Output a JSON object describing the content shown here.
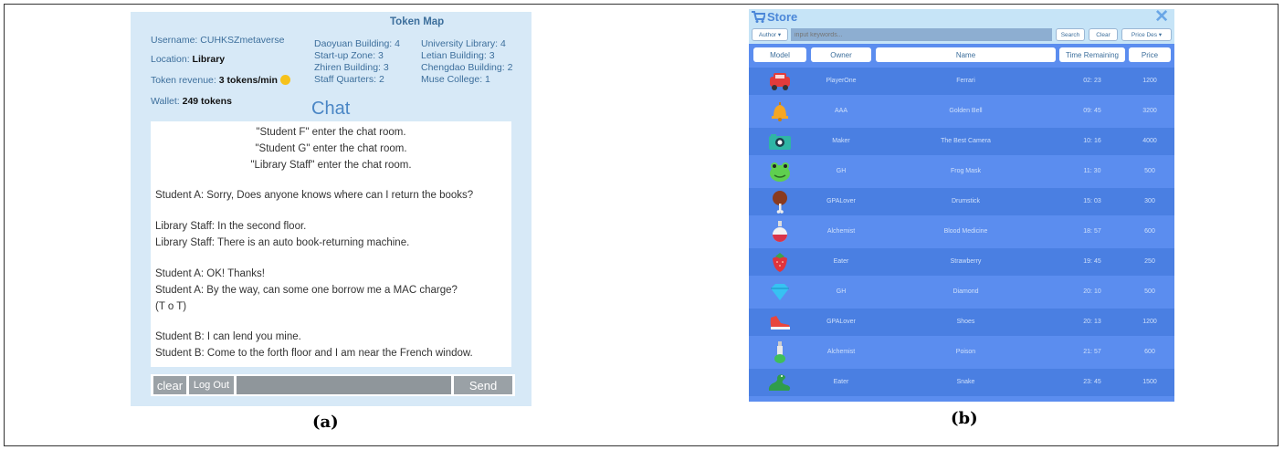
{
  "captions": {
    "a": "(a)",
    "b": "(b)"
  },
  "panel_a": {
    "username_label": "Username: ",
    "username_value": "CUHKSZmetaverse",
    "location_label": "Location: ",
    "location_value": "Library",
    "token_revenue_label": "Token revenue: ",
    "token_revenue_value": "3 tokens/min",
    "wallet_label": "Wallet: ",
    "wallet_value": "249 tokens",
    "token_map_title": "Token Map",
    "token_map_left": [
      "Daoyuan Building: 4",
      "Start-up Zone: 3",
      "Zhiren Building: 3",
      "Staff Quarters: 2"
    ],
    "token_map_right": [
      "University Library: 4",
      "Letian Building: 3",
      "Chengdao Building: 2",
      "Muse College: 1"
    ],
    "chat_title": "Chat",
    "chat_lines": [
      "\"Student F\" enter the chat room.",
      "\"Student G\" enter the chat room.",
      "\"Library Staff\" enter the chat room.",
      "Student A: Sorry, Does anyone knows where can I return the books?",
      "Library Staff: In the second floor.",
      "Library Staff: There is an auto book-returning machine.",
      "Student A: OK! Thanks!",
      "Student A: By the way, can some one borrow me a MAC charge?",
      "(T o T)",
      "Student B: I can lend you mine.",
      "Student B: Come to the forth floor and I am near the French window."
    ],
    "clear_label": "clear",
    "logout_label": "Log Out",
    "send_label": "Send",
    "input_placeholder": ""
  },
  "panel_b": {
    "title": "Store",
    "close_label": "✕",
    "author_label": "Author ▾",
    "search_placeholder": "input keywords...",
    "search_label": "Search",
    "clear_label": "Clear",
    "sort_label": "Price Des ▾",
    "columns": [
      "Model",
      "Owner",
      "Name",
      "Time Remaining",
      "Price"
    ],
    "items": [
      {
        "icon": "car-icon",
        "owner": "PlayerOne",
        "name": "Ferrari",
        "time": "02: 23",
        "price": "1200",
        "color": "#e23b3b"
      },
      {
        "icon": "bell-icon",
        "owner": "AAA",
        "name": "Golden Bell",
        "time": "09: 45",
        "price": "3200",
        "color": "#f5a623"
      },
      {
        "icon": "camera-icon",
        "owner": "Maker",
        "name": "The Best Camera",
        "time": "10: 16",
        "price": "4000",
        "color": "#2fb5a5"
      },
      {
        "icon": "frog-mask-icon",
        "owner": "GH",
        "name": "Frog Mask",
        "time": "11: 30",
        "price": "500",
        "color": "#5fcf4f"
      },
      {
        "icon": "drumstick-icon",
        "owner": "GPALover",
        "name": "Drumstick",
        "time": "15: 03",
        "price": "300",
        "color": "#8a3b1f"
      },
      {
        "icon": "potion-icon",
        "owner": "Alchemist",
        "name": "Blood Medicine",
        "time": "18: 57",
        "price": "600",
        "color": "#d8344a"
      },
      {
        "icon": "strawberry-icon",
        "owner": "Eater",
        "name": "Strawberry",
        "time": "19: 45",
        "price": "250",
        "color": "#e0343c"
      },
      {
        "icon": "diamond-icon",
        "owner": "GH",
        "name": "Diamond",
        "time": "20: 10",
        "price": "500",
        "color": "#37c2f2"
      },
      {
        "icon": "shoes-icon",
        "owner": "GPALover",
        "name": "Shoes",
        "time": "20: 13",
        "price": "1200",
        "color": "#e8463c"
      },
      {
        "icon": "poison-icon",
        "owner": "Alchemist",
        "name": "Poison",
        "time": "21: 57",
        "price": "600",
        "color": "#3fbf5a"
      },
      {
        "icon": "snake-icon",
        "owner": "Eater",
        "name": "Snake",
        "time": "23: 45",
        "price": "1500",
        "color": "#2f9d4a"
      }
    ]
  }
}
